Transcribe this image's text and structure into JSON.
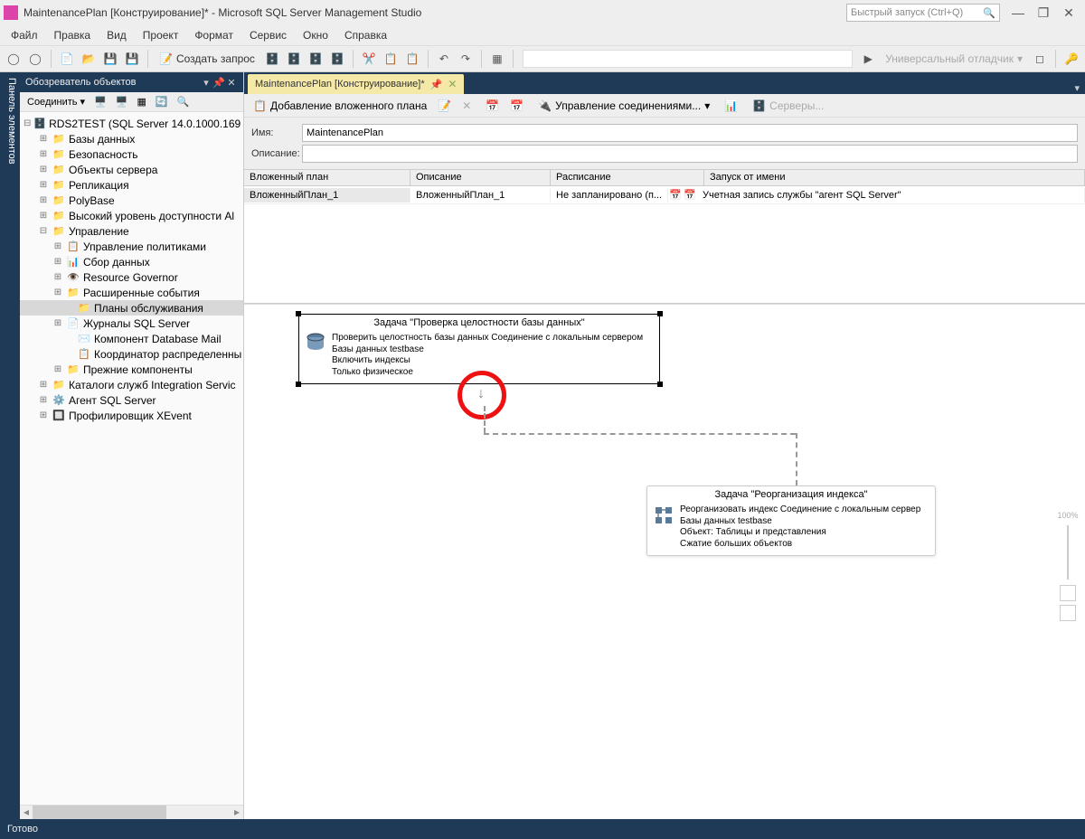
{
  "titlebar": {
    "title": "MaintenancePlan [Конструирование]* - Microsoft SQL Server Management Studio",
    "quick_launch": "Быстрый запуск (Ctrl+Q)"
  },
  "menu": {
    "file": "Файл",
    "edit": "Правка",
    "view": "Вид",
    "project": "Проект",
    "format": "Формат",
    "service": "Сервис",
    "window": "Окно",
    "help": "Справка"
  },
  "toolbar": {
    "new_query": "Создать запрос",
    "debugger": "Универсальный отладчик"
  },
  "left_strip": "Панель элементов",
  "explorer": {
    "title": "Обозреватель объектов",
    "connect": "Соединить",
    "server": "RDS2TEST (SQL Server 14.0.1000.169 - A",
    "databases": "Базы данных",
    "security": "Безопасность",
    "server_objects": "Объекты сервера",
    "replication": "Репликация",
    "polybase": "PolyBase",
    "alwayson": "Высокий уровень доступности Al",
    "management": "Управление",
    "policy_mgmt": "Управление политиками",
    "data_collection": "Сбор данных",
    "resource_gov": "Resource Governor",
    "extended_events": "Расширенные события",
    "maint_plans": "Планы обслуживания",
    "sql_logs": "Журналы SQL Server",
    "db_mail": "Компонент Database Mail",
    "coordinator": "Координатор распределенны",
    "legacy": "Прежние компоненты",
    "integration": "Каталоги служб Integration Servic",
    "sql_agent": "Агент SQL Server",
    "xevent": "Профилировщик XEvent"
  },
  "document": {
    "tab": "MaintenancePlan [Конструирование]*",
    "toolbar": {
      "add_subplan": "Добавление вложенного плана",
      "manage_conn": "Управление соединениями...",
      "servers": "Серверы..."
    },
    "name_label": "Имя:",
    "name_value": "MaintenancePlan",
    "desc_label": "Описание:",
    "desc_value": "",
    "grid": {
      "headers": {
        "subplan": "Вложенный план",
        "desc": "Описание",
        "schedule": "Расписание",
        "runas": "Запуск от имени"
      },
      "row": {
        "subplan": "ВложенныйПлан_1",
        "desc": "ВложенныйПлан_1",
        "schedule": "Не запланировано (п...",
        "runas": "Учетная запись службы \"агент SQL Server\""
      }
    }
  },
  "task1": {
    "title": "Задача \"Проверка целостности базы данных\"",
    "line1": "Проверить целостность базы данных Соединение с локальным сервером",
    "line2": "Базы данных testbase",
    "line3": "Включить индексы",
    "line4": "Только физическое"
  },
  "task2": {
    "title": "Задача \"Реорганизация индекса\"",
    "line1": "Реорганизовать индекс Соединение с локальным сервер",
    "line2": "Базы данных testbase",
    "line3": "Объект: Таблицы и представления",
    "line4": "Сжатие больших объектов"
  },
  "zoom": "100%",
  "status": "Готово"
}
